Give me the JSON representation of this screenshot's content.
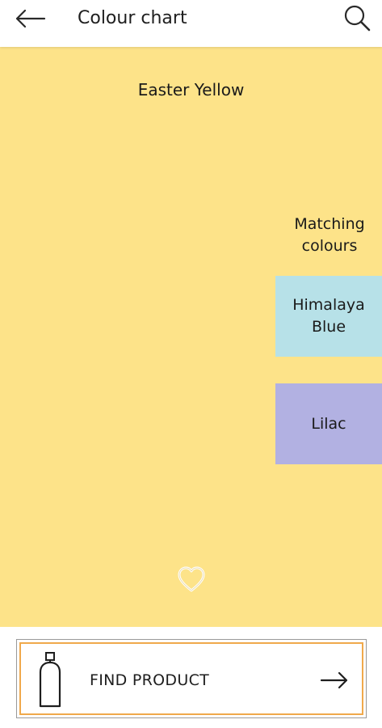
{
  "header": {
    "title": "Colour chart",
    "back_icon": "arrow-left-icon",
    "search_icon": "search-icon"
  },
  "colour": {
    "name": "Easter Yellow",
    "hex": "#FDE389"
  },
  "matching": {
    "heading": "Matching colours",
    "swatches": [
      {
        "name": "Himalaya Blue",
        "hex": "#B7E1E8"
      },
      {
        "name": "Lilac",
        "hex": "#B2B1E2"
      }
    ]
  },
  "favourite": {
    "icon": "heart-outline-icon"
  },
  "find_product": {
    "label": "FIND PRODUCT",
    "border_color": "#F0A94B",
    "left_icon": "spray-can-icon",
    "right_icon": "arrow-right-icon"
  }
}
